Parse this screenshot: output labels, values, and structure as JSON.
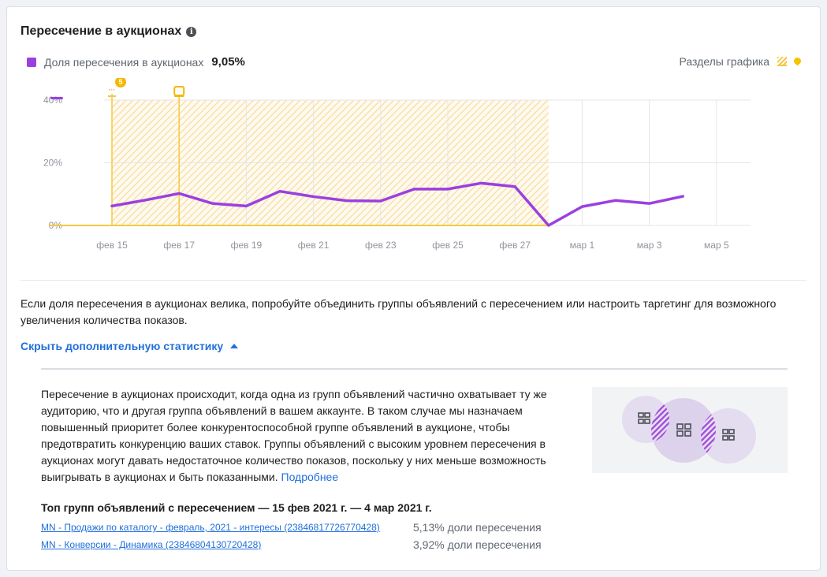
{
  "card": {
    "title": "Пересечение в аукционах",
    "info_icon": "info-icon"
  },
  "legend": {
    "label": "Доля пересечения в аукционах",
    "value": "9,05%",
    "color": "#9b40e0"
  },
  "sections": {
    "label": "Разделы графика",
    "icons": [
      "hatch-icon",
      "annotation-dot-icon"
    ]
  },
  "markers": [
    {
      "label": "5",
      "icon": "count-badge-icon"
    },
    {
      "label": "",
      "icon": "annotation-icon"
    }
  ],
  "chart_data": {
    "type": "line",
    "x": [
      "фев 15",
      "фев 16",
      "фев 17",
      "фев 18",
      "фев 19",
      "фев 20",
      "фев 21",
      "фев 22",
      "фев 23",
      "фев 24",
      "фев 25",
      "фев 26",
      "фев 27",
      "фев 28",
      "мар 1",
      "мар 2",
      "мар 3",
      "мар 4"
    ],
    "x_tick_labels": [
      "фев 15",
      "фев 17",
      "фев 19",
      "фев 21",
      "фев 23",
      "фев 25",
      "фев 27",
      "мар 1",
      "мар 3",
      "мар 5"
    ],
    "series": [
      {
        "values": [
          6.2,
          8.1,
          10.2,
          7.0,
          6.2,
          10.9,
          9.2,
          7.9,
          7.8,
          11.6,
          11.6,
          13.5,
          12.4,
          0.0,
          6.0,
          8.0,
          7.0,
          9.3
        ]
      }
    ],
    "ylim": [
      0,
      40
    ],
    "y_tick_labels": [
      "0%",
      "20%",
      "40%"
    ],
    "highlighted_range": [
      "фев 15",
      "фев 28"
    ],
    "grid": true,
    "line_color": "#9b40e0",
    "highlight_color": "#f5c842"
  },
  "hint_text": "Если доля пересечения в аукционах велика, попробуйте объединить группы объявлений с пересечением или настроить таргетинг для возможного увеличения количества показов.",
  "toggle_label": "Скрыть дополнительную статистику",
  "description": {
    "text": "Пересечение в аукционах происходит, когда одна из групп объявлений частично охватывает ту же аудиторию, что и другая группа объявлений в вашем аккаунте. В таком случае мы назначаем повышенный приоритет более конкурентоспособной группе объявлений в аукционе, чтобы предотвратить конкуренцию ваших ставок. Группы объявлений с высоким уровнем пересечения в аукционах могут давать недостаточное количество показов, поскольку у них меньше возможность выигрывать в аукционах и быть показанными.",
    "link": "Подробнее"
  },
  "top": {
    "title": "Топ групп объявлений с пересечением — 15 фев 2021 г. — 4 мар 2021 г.",
    "rows": [
      {
        "name": "MN - Продажи по каталогу - февраль, 2021 - интересы (23846817726770428)",
        "pct": "5,13% доли пересечения"
      },
      {
        "name": "MN - Конверсии - Динамика (23846804130720428)",
        "pct": "3,92% доли пересечения"
      }
    ]
  }
}
